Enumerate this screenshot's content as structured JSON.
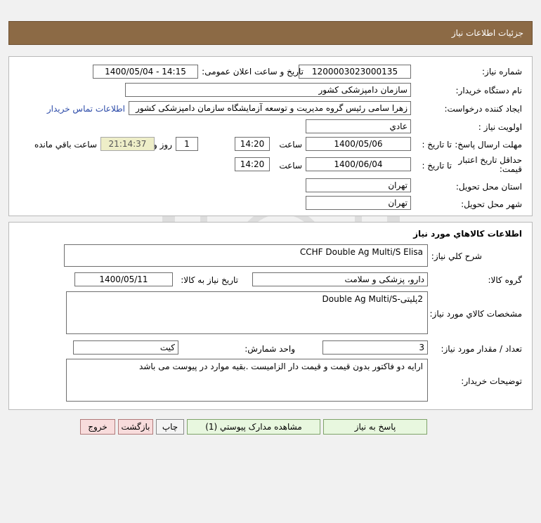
{
  "header": {
    "title": "جزئیات اطلاعات نیاز"
  },
  "details": {
    "need_number_label": "شماره نیاز:",
    "need_number": "1200003023000135",
    "announce_label": "تاریخ و ساعت اعلان عمومی:",
    "announce_value": "1400/05/04 - 14:15",
    "buyer_org_label": "نام دستگاه خریدار:",
    "buyer_org": "سازمان دامپزشکی کشور",
    "creator_label": "ایجاد کننده درخواست:",
    "creator": "زهرا سامی  رئیس گروه مدیریت و توسعه آزمایشگاه سازمان دامپزشکی کشور",
    "contact_link": "اطلاعات تماس خریدار",
    "priority_label": "اولویت نیاز :",
    "priority": "عادي",
    "deadline_label": "مهلت ارسال پاسخ:",
    "to_date_label": "تا تاریخ :",
    "deadline_date": "1400/05/06",
    "time_label": "ساعت",
    "deadline_time": "14:20",
    "days_value": "1",
    "days_label": "روز و",
    "remaining_time": "21:14:37",
    "remaining_label": "ساعت باقي مانده",
    "validity_label": "حداقل تاریخ اعتبار قیمت:",
    "validity_to_label": "تا تاریخ :",
    "validity_date": "1400/06/04",
    "validity_time_label": "ساعت",
    "validity_time": "14:20",
    "province_label": "استان محل تحویل:",
    "province": "تهران",
    "city_label": "شهر محل تحویل:",
    "city": "تهران"
  },
  "goods": {
    "section_title": "اطلاعات کالاهاي مورد نياز",
    "desc_label": "شرح کلي نياز:",
    "desc": "CCHF Double Ag Multi/S Elisa",
    "group_label": "گروه کالا:",
    "group": "دارو، پزشکی و سلامت",
    "need_date_label": "تاریخ نیاز به کالا:",
    "need_date": "1400/05/11",
    "spec_label": "مشخصات کالاي مورد نياز:",
    "spec": "2پلیتی-Double Ag Multi/S",
    "qty_label": "تعداد / مقدار مورد نیاز:",
    "qty": "3",
    "unit_label": "واحد شمارش:",
    "unit": "کیت",
    "buyer_notes_label": "توضیحات خریدار:",
    "buyer_notes": "ارایه دو فاکتور بدون قیمت و قیمت دار الزامیست .بقیه موارد در پیوست می باشد"
  },
  "buttons": {
    "respond": "پاسخ به نیاز",
    "attachments": "مشاهده مدارک پیوستي (1)",
    "print": "چاپ",
    "back": "بازگشت",
    "exit": "خروج"
  }
}
